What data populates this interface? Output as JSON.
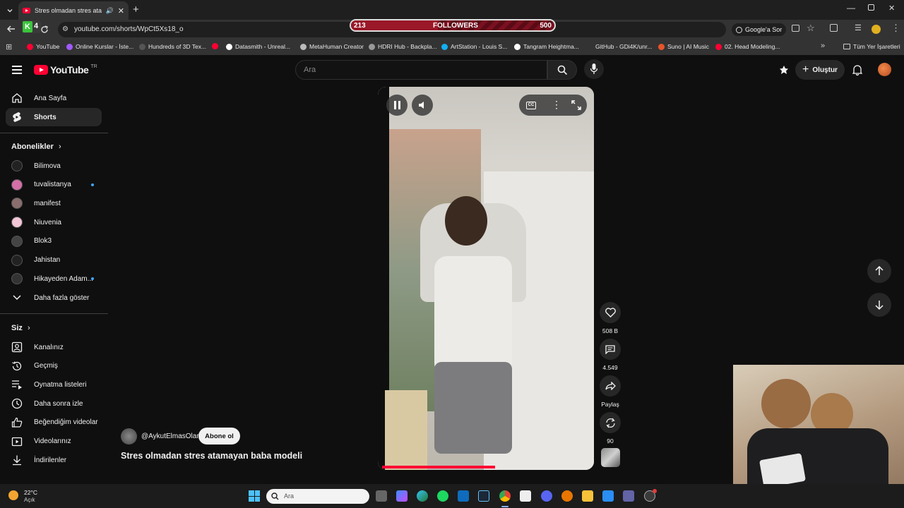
{
  "browser": {
    "tab_title": "Stres olmadan stres atamay",
    "url": "youtube.com/shorts/WpCt5Xs18_o",
    "google_ask": "Google'a Sor",
    "all_bookmarks": "Tüm Yer İşaretleri",
    "bookmarks": [
      {
        "label": "YouTube",
        "color": "#ff0033"
      },
      {
        "label": "Online Kurslar - İste...",
        "color": "#a259ff"
      },
      {
        "label": "Hundreds of 3D Tex...",
        "color": "#555555"
      },
      {
        "label": "",
        "color": "#ff0033"
      },
      {
        "label": "Datasmith - Unreal...",
        "color": "#ffffff"
      },
      {
        "label": "MetaHuman Creator",
        "color": "#bbbbbb"
      },
      {
        "label": "HDRI Hub - Backpla...",
        "color": "#999999"
      },
      {
        "label": "ArtStation - Louis S...",
        "color": "#13aff0"
      },
      {
        "label": "Tangram Heightma...",
        "color": "#ffffff"
      },
      {
        "label": "GitHub - GDi4K/unr...",
        "color": "#333333"
      },
      {
        "label": "Suno | AI Music",
        "color": "#e8542a"
      },
      {
        "label": "02. Head Modeling...",
        "color": "#ff0033"
      }
    ]
  },
  "overlay": {
    "followers_label": "FOLLOWERS",
    "followers_current": "213",
    "followers_goal": "500",
    "progress": 0.426,
    "k_badge": "4"
  },
  "youtube": {
    "logo": "YouTube",
    "logo_suffix": "TR",
    "search_placeholder": "Ara",
    "create_label": "Oluştur",
    "nav": {
      "home": "Ana Sayfa",
      "shorts": "Shorts"
    },
    "subscriptions_title": "Abonelikler",
    "subscriptions": [
      {
        "name": "Bilimova",
        "color": "#222222",
        "new": false
      },
      {
        "name": "tuvalistanya",
        "color": "#d46fa8",
        "new": true
      },
      {
        "name": "manifest",
        "color": "#8a6d6d",
        "new": false
      },
      {
        "name": "Niuvenia",
        "color": "#f2c6d6",
        "new": false
      },
      {
        "name": "Blok3",
        "color": "#444444",
        "new": false
      },
      {
        "name": "Jahistan",
        "color": "#222222",
        "new": false
      },
      {
        "name": "Hikayeden Adam...",
        "color": "#333333",
        "new": true
      }
    ],
    "show_more": "Daha fazla göster",
    "you_title": "Siz",
    "you_items": [
      {
        "name": "Kanalınız",
        "icon": "channel-icon"
      },
      {
        "name": "Geçmiş",
        "icon": "history-icon"
      },
      {
        "name": "Oynatma listeleri",
        "icon": "playlists-icon"
      },
      {
        "name": "Daha sonra izle",
        "icon": "watch-later-icon"
      },
      {
        "name": "Beğendiğim videolar",
        "icon": "liked-icon"
      },
      {
        "name": "Videolarınız",
        "icon": "your-videos-icon"
      },
      {
        "name": "İndirilenler",
        "icon": "downloads-icon"
      }
    ],
    "short": {
      "channel": "@AykutElmasOlan",
      "subscribe": "Abone ol",
      "title": "Stres olmadan stres atamayan baba modeli",
      "likes": "508 B",
      "comments": "4.549",
      "share": "Paylaş",
      "remix": "90"
    }
  },
  "taskbar": {
    "weather_temp": "22°C",
    "weather_desc": "Açık",
    "search_placeholder": "Ara"
  }
}
